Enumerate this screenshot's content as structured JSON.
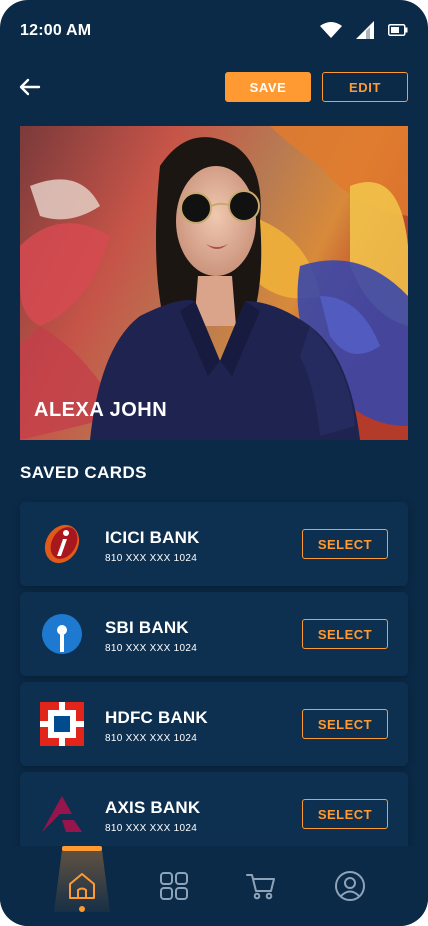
{
  "status_bar": {
    "time": "12:00 AM"
  },
  "header": {
    "save_label": "SAVE",
    "edit_label": "EDIT"
  },
  "profile": {
    "name": "ALEXA JOHN"
  },
  "saved_cards": {
    "title": "SAVED CARDS",
    "items": [
      {
        "bank": "ICICI BANK",
        "number": "810 XXX XXX 1024",
        "select_label": "SELECT",
        "logo": "icici-logo"
      },
      {
        "bank": "SBI BANK",
        "number": "810 XXX XXX 1024",
        "select_label": "SELECT",
        "logo": "sbi-logo"
      },
      {
        "bank": "HDFC BANK",
        "number": "810 XXX XXX 1024",
        "select_label": "SELECT",
        "logo": "hdfc-logo"
      },
      {
        "bank": "AXIS BANK",
        "number": "810 XXX XXX 1024",
        "select_label": "SELECT",
        "logo": "axis-logo"
      }
    ]
  },
  "bottom_nav": {
    "items": [
      {
        "icon": "home-icon",
        "active": true
      },
      {
        "icon": "grid-icon",
        "active": false
      },
      {
        "icon": "cart-icon",
        "active": false
      },
      {
        "icon": "profile-icon",
        "active": false
      }
    ]
  },
  "colors": {
    "background": "#0b2a48",
    "card": "#0e3050",
    "accent": "#ff9a33"
  }
}
